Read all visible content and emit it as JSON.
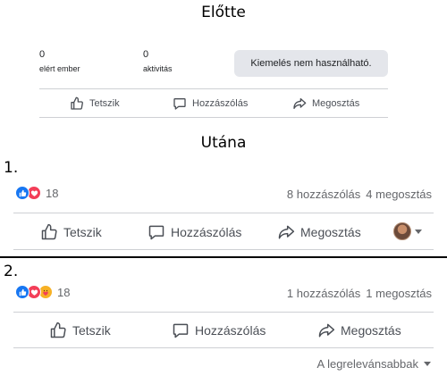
{
  "before": {
    "title": "Előtte",
    "reached_value": "0",
    "reached_label": "elért ember",
    "activity_value": "0",
    "activity_label": "aktivitás",
    "promote_label": "Kiemelés nem használható.",
    "like_label": "Tetszik",
    "comment_label": "Hozzászólás",
    "share_label": "Megosztás"
  },
  "after": {
    "title": "Utána",
    "variant1": {
      "number": "1.",
      "reaction_count": "18",
      "comments_count": "8 hozzászólás",
      "shares_count": "4 megosztás",
      "like_label": "Tetszik",
      "comment_label": "Hozzászólás",
      "share_label": "Megosztás"
    },
    "variant2": {
      "number": "2.",
      "reaction_count": "18",
      "comments_count": "1 hozzászólás",
      "shares_count": "1 megosztás",
      "like_label": "Tetszik",
      "comment_label": "Hozzászólás",
      "share_label": "Megosztás",
      "sort_label": "A legrelevánsabbak"
    }
  },
  "colors": {
    "like_blue": "#1877f2",
    "love_red": "#f33e58",
    "care_yellow": "#f7b125",
    "button_bg": "#e4e6eb"
  },
  "icons": [
    "thumbs-up-icon",
    "comment-icon",
    "share-icon",
    "like-reaction-icon",
    "love-reaction-icon",
    "care-reaction-icon",
    "avatar",
    "chevron-down-icon"
  ]
}
